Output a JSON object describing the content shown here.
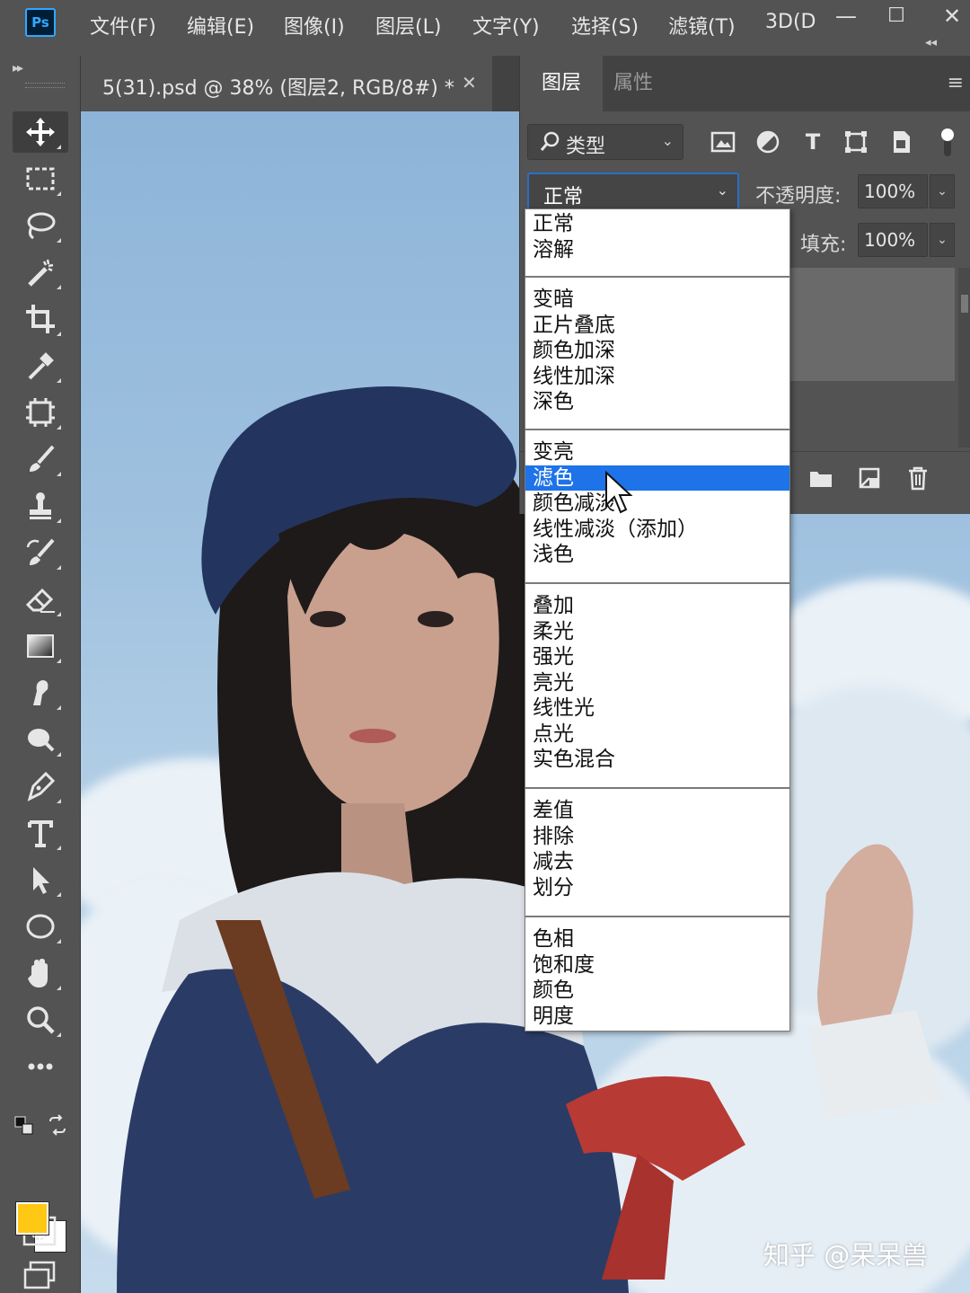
{
  "app": {
    "logo": "Ps"
  },
  "menu": [
    {
      "label": "文件(F)"
    },
    {
      "label": "编辑(E)"
    },
    {
      "label": "图像(I)"
    },
    {
      "label": "图层(L)"
    },
    {
      "label": "文字(Y)"
    },
    {
      "label": "选择(S)"
    },
    {
      "label": "滤镜(T)"
    },
    {
      "label": "3D(D"
    }
  ],
  "window_controls": {
    "minimize": "—",
    "maximize": "☐",
    "close": "✕"
  },
  "panel_toggle": "◂◂",
  "toolbar": {
    "grip": "▸▸",
    "tools": [
      {
        "icon": "move-icon"
      },
      {
        "icon": "marquee-icon"
      },
      {
        "icon": "lasso-icon"
      },
      {
        "icon": "magic-wand-icon"
      },
      {
        "icon": "crop-icon"
      },
      {
        "icon": "eyedropper-icon"
      },
      {
        "icon": "frame-icon"
      },
      {
        "icon": "brush-icon"
      },
      {
        "icon": "clone-stamp-icon"
      },
      {
        "icon": "history-brush-icon"
      },
      {
        "icon": "eraser-icon"
      },
      {
        "icon": "gradient-icon"
      },
      {
        "icon": "smudge-icon"
      },
      {
        "icon": "dodge-icon"
      },
      {
        "icon": "pen-icon"
      },
      {
        "icon": "type-icon"
      },
      {
        "icon": "path-select-icon"
      },
      {
        "icon": "ellipse-icon"
      },
      {
        "icon": "hand-icon"
      },
      {
        "icon": "zoom-icon"
      },
      {
        "icon": "more-tools-icon"
      }
    ],
    "foreground_color": "#ffc814",
    "background_color": "#ffffff"
  },
  "document": {
    "tab_label": "5(31).psd @ 38% (图层2, RGB/8#) *",
    "close": "✕"
  },
  "layers_panel": {
    "tabs": {
      "layers": "图层",
      "properties": "属性"
    },
    "menu": "≡",
    "filter": {
      "label": "类型",
      "chevron": "⌄"
    },
    "filter_icons": [
      {
        "icon": "image-filter-icon"
      },
      {
        "icon": "adjustment-filter-icon"
      },
      {
        "icon": "type-filter-icon",
        "glyph": "T"
      },
      {
        "icon": "shape-filter-icon"
      },
      {
        "icon": "smart-object-filter-icon"
      }
    ],
    "blend_mode": {
      "value": "正常",
      "chevron": "⌄"
    },
    "opacity": {
      "label": "不透明度:",
      "value": "100%",
      "chevron": "⌄"
    },
    "fill": {
      "label": "填充:",
      "value": "100%",
      "chevron": "⌄"
    },
    "footer_icons": [
      {
        "icon": "new-group-icon"
      },
      {
        "icon": "new-layer-icon"
      },
      {
        "icon": "delete-layer-icon"
      }
    ]
  },
  "blend_menu": {
    "groups": [
      [
        "正常",
        "溶解"
      ],
      [
        "变暗",
        "正片叠底",
        "颜色加深",
        "线性加深",
        "深色"
      ],
      [
        "变亮",
        "滤色",
        "颜色减淡",
        "线性减淡（添加）",
        "浅色"
      ],
      [
        "叠加",
        "柔光",
        "强光",
        "亮光",
        "线性光",
        "点光",
        "实色混合"
      ],
      [
        "差值",
        "排除",
        "减去",
        "划分"
      ],
      [
        "色相",
        "饱和度",
        "颜色",
        "明度"
      ]
    ],
    "selected": "滤色",
    "accent_color": "#1e73e8"
  },
  "watermark": "知乎 @呆呆兽"
}
